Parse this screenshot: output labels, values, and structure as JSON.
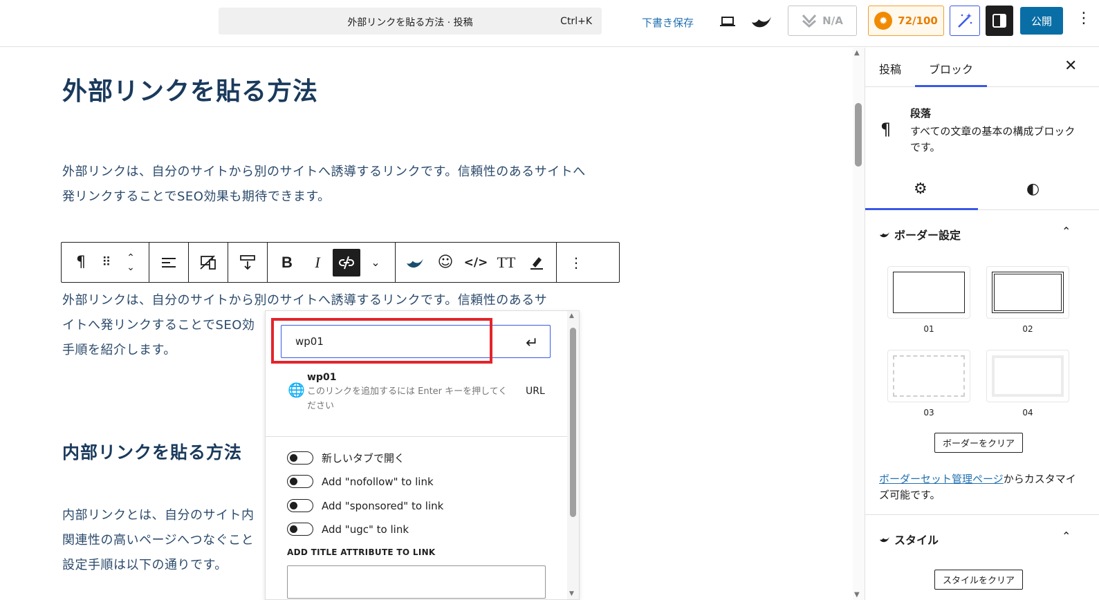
{
  "topbar": {
    "command_title": "外部リンクを貼る方法 · 投稿",
    "command_shortcut": "Ctrl+K",
    "save_draft": "下書き保存",
    "na_label": "N/A",
    "score": "72/100",
    "publish": "公開"
  },
  "editor": {
    "post_title": "外部リンクを貼る方法",
    "paragraph1": "外部リンクは、自分のサイトから別のサイトへ誘導するリンクです。信頼性のあるサイトへ発リンクすることでSEO効果も期待できます。",
    "paragraph2_line1": "外部リンクは、自分のサイトから別のサイトへ誘導するリンクです。信頼性のあるサ",
    "paragraph2_line2": "イトへ発リンクすることでSEO効",
    "paragraph2_line3": "手順を紹介します。",
    "heading2": "内部リンクを貼る方法",
    "paragraph3_line1": "内部リンクとは、自分のサイト内",
    "paragraph3_line2": "関連性の高いページへつなぐこと",
    "paragraph3_line3": "設定手順は以下の通りです。"
  },
  "link_popover": {
    "url_value": "wp01",
    "suggestion_title": "wp01",
    "suggestion_desc": "このリンクを追加するには Enter キーを押してください",
    "suggestion_type": "URL",
    "toggles": [
      {
        "label": "新しいタブで開く",
        "on": false
      },
      {
        "label": "Add \"nofollow\" to link",
        "on": false
      },
      {
        "label": "Add \"sponsored\" to link",
        "on": false
      },
      {
        "label": "Add \"ugc\" to link",
        "on": false
      }
    ],
    "title_attr_label": "ADD TITLE ATTRIBUTE TO LINK",
    "title_attr_value": ""
  },
  "sidebar": {
    "tab_post": "投稿",
    "tab_block": "ブロック",
    "block_name": "段落",
    "block_desc": "すべての文章の基本の構成ブロックです。",
    "border_section": "ボーダー設定",
    "border_options": [
      "01",
      "02",
      "03",
      "04"
    ],
    "clear_border": "ボーダーをクリア",
    "note_link": "ボーダーセット管理ページ",
    "note_rest": "からカスタマイズ可能です。",
    "style_section": "スタイル",
    "clear_style": "スタイルをクリア"
  },
  "colors": {
    "accent": "#3858e9",
    "publish": "#0a6ea6",
    "highlight": "#e3242b",
    "score": "#f08a00",
    "title_text": "#1a3a5c"
  }
}
